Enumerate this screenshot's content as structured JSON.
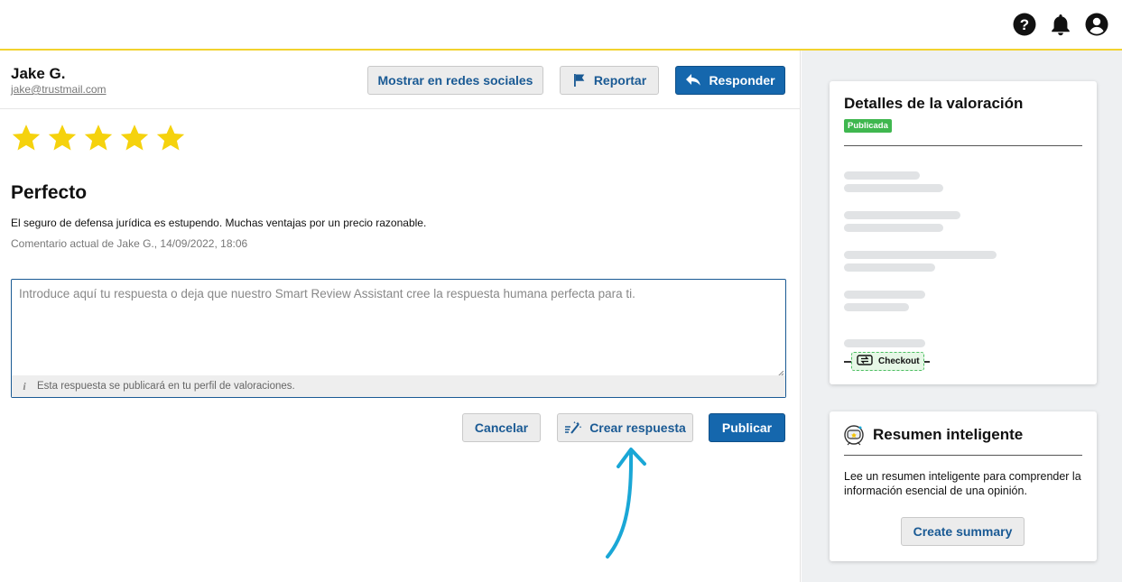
{
  "topbar": {
    "icons": [
      "help-icon",
      "bell-icon",
      "user-account-icon"
    ],
    "accent_color": "#f2d22e"
  },
  "review": {
    "reviewer_name": "Jake G.",
    "reviewer_email": "jake@trustmail.com",
    "rating": 5,
    "rating_max": 5,
    "star_color": "#f5d20d",
    "title": "Perfecto",
    "text": "El seguro de defensa jurídica es estupendo. Muchas ventajas por un precio razonable.",
    "meta": "Comentario actual de Jake G., 14/09/2022, 18:06"
  },
  "actions": {
    "share_label": "Mostrar en redes sociales",
    "report_label": "Reportar",
    "reply_label": "Responder"
  },
  "reply": {
    "placeholder": "Introduce aquí tu respuesta o deja que nuestro Smart Review Assistant cree la respuesta humana perfecta para ti.",
    "value": "",
    "info": "Esta respuesta se publicará en tu perfil de valoraciones.",
    "cancel_label": "Cancelar",
    "generate_label": "Crear respuesta",
    "publish_label": "Publicar"
  },
  "details_card": {
    "title": "Detalles de la valoración",
    "status": "Publicada",
    "status_color": "#3fb74f",
    "checkout_label": "Checkout"
  },
  "summary_card": {
    "title": "Resumen inteligente",
    "description": "Lee un resumen inteligente para comprender la información esencial de una opinión.",
    "button_label": "Create summary"
  },
  "colors": {
    "primary": "#1567ad",
    "annotation_arrow": "#1aa7d6"
  }
}
